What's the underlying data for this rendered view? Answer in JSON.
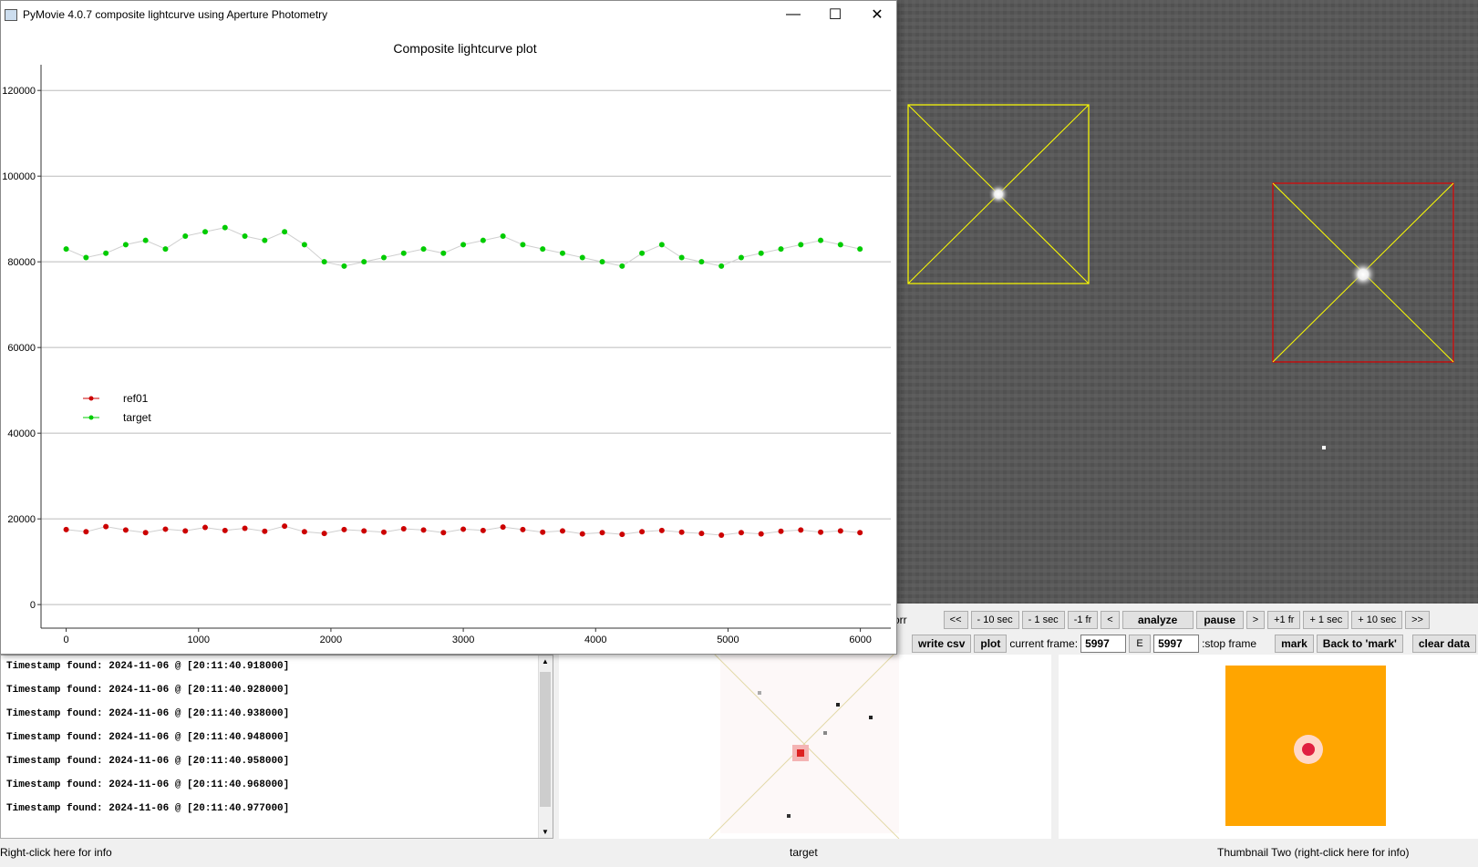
{
  "window": {
    "title": "PyMovie 4.0.7 composite lightcurve using Aperture Photometry",
    "minimize_glyph": "—",
    "maximize_glyph": "☐",
    "close_glyph": "✕"
  },
  "chart_data": {
    "type": "scatter",
    "title": "Composite lightcurve plot",
    "xlabel": "",
    "ylabel": "",
    "xlim": [
      -190,
      6230
    ],
    "ylim": [
      -5500,
      126000
    ],
    "x_ticks": [
      0,
      1000,
      2000,
      3000,
      4000,
      5000,
      6000
    ],
    "y_ticks": [
      0,
      20000,
      40000,
      60000,
      80000,
      100000,
      120000
    ],
    "x_tick_labels": [
      "0",
      "1000",
      "2000",
      "3000",
      "4000",
      "5000",
      "6000"
    ],
    "y_tick_labels": [
      "0",
      "20000",
      "40000",
      "60000",
      "80000",
      "100000",
      "120000"
    ],
    "grid": "horizontal",
    "legend_position": "left, mid-height",
    "series": [
      {
        "name": "ref01",
        "color": "#cc0000",
        "x": [
          0,
          150,
          300,
          450,
          600,
          750,
          900,
          1050,
          1200,
          1350,
          1500,
          1650,
          1800,
          1950,
          2100,
          2250,
          2400,
          2550,
          2700,
          2850,
          3000,
          3150,
          3300,
          3450,
          3600,
          3750,
          3900,
          4050,
          4200,
          4350,
          4500,
          4650,
          4800,
          4950,
          5100,
          5250,
          5400,
          5550,
          5700,
          5850,
          5997
        ],
        "y": [
          17500,
          17000,
          18200,
          17400,
          16800,
          17600,
          17200,
          18000,
          17300,
          17800,
          17100,
          18300,
          17000,
          16600,
          17500,
          17200,
          16900,
          17700,
          17400,
          16800,
          17600,
          17300,
          18100,
          17500,
          16900,
          17200,
          16500,
          16800,
          16400,
          17000,
          17300,
          16900,
          16600,
          16200,
          16800,
          16500,
          17100,
          17400,
          16900,
          17200,
          16800
        ]
      },
      {
        "name": "target",
        "color": "#00cc00",
        "x": [
          0,
          150,
          300,
          450,
          600,
          750,
          900,
          1050,
          1200,
          1350,
          1500,
          1650,
          1800,
          1950,
          2100,
          2250,
          2400,
          2550,
          2700,
          2850,
          3000,
          3150,
          3300,
          3450,
          3600,
          3750,
          3900,
          4050,
          4200,
          4350,
          4500,
          4650,
          4800,
          4950,
          5100,
          5250,
          5400,
          5550,
          5700,
          5850,
          5997
        ],
        "y": [
          83000,
          81000,
          82000,
          84000,
          85000,
          83000,
          86000,
          87000,
          88000,
          86000,
          85000,
          87000,
          84000,
          80000,
          79000,
          80000,
          81000,
          82000,
          83000,
          82000,
          84000,
          85000,
          86000,
          84000,
          83000,
          82000,
          81000,
          80000,
          79000,
          82000,
          84000,
          81000,
          80000,
          79000,
          81000,
          82000,
          83000,
          84000,
          85000,
          84000,
          83000
        ]
      }
    ]
  },
  "controls": {
    "row1": [
      "orr",
      "<<",
      "- 10 sec",
      "- 1 sec",
      "-1 fr",
      "<",
      "analyze",
      "pause",
      ">",
      "+1 fr",
      "+ 1 sec",
      "+ 10 sec",
      ">>"
    ],
    "write_csv": "write csv",
    "plot": "plot",
    "current_frame_label": "current frame:",
    "current_frame_value": "5997",
    "e_label": "E",
    "stop_frame_value": "5997",
    "stop_frame_label": ":stop frame",
    "mark": "mark",
    "back_to_mark": "Back to 'mark'",
    "clear_data": "clear data"
  },
  "log": {
    "lines": [
      "Timestamp found: 2024-11-06 @ [20:11:40.918000]",
      "Timestamp found: 2024-11-06 @ [20:11:40.928000]",
      "Timestamp found: 2024-11-06 @ [20:11:40.938000]",
      "Timestamp found: 2024-11-06 @ [20:11:40.948000]",
      "Timestamp found: 2024-11-06 @ [20:11:40.958000]",
      "Timestamp found: 2024-11-06 @ [20:11:40.968000]",
      "Timestamp found: 2024-11-06 @ [20:11:40.977000]"
    ],
    "caption": "Right-click here for info"
  },
  "thumbnails": {
    "one_caption": "target",
    "two_caption": "Thumbnail Two (right-click here for info)",
    "two_background": "#ffa500"
  },
  "apertures": [
    {
      "name": "ref01",
      "color": "#ffff00"
    },
    {
      "name": "target",
      "color": "#dd0000"
    }
  ]
}
